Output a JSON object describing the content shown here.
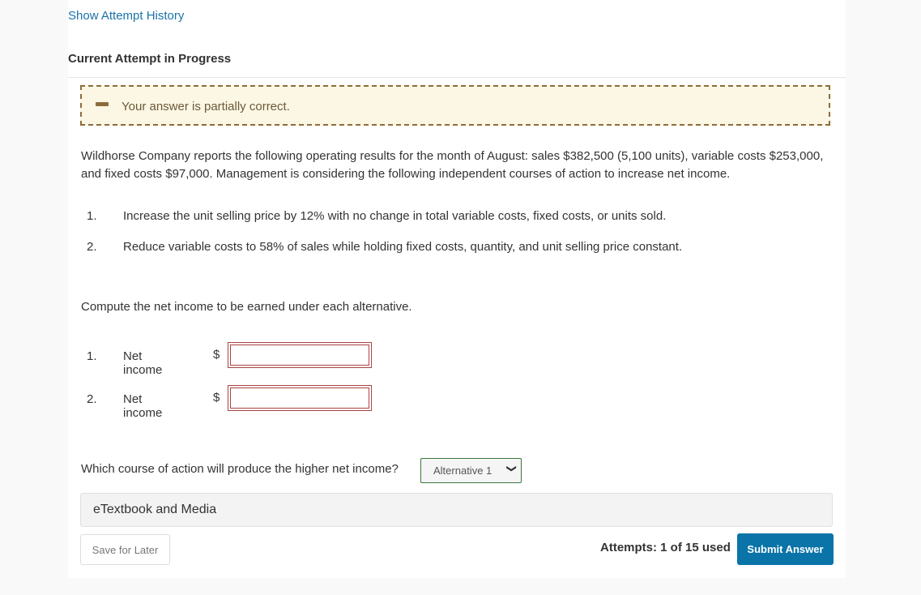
{
  "header": {
    "history_link": "Show Attempt History",
    "attempt_title": "Current Attempt in Progress"
  },
  "feedback": {
    "icon": "minus-icon",
    "message": "Your answer is partially correct."
  },
  "problem": {
    "statement": "Wildhorse Company reports the following operating results for the month of August: sales $382,500 (5,100 units), variable costs $253,000, and fixed costs $97,000. Management is considering the following independent courses of action to increase net income.",
    "alternatives": [
      {
        "num": "1.",
        "text": "Increase the unit selling price by 12% with no change in total variable costs, fixed costs, or units sold."
      },
      {
        "num": "2.",
        "text": "Reduce variable costs to 58% of sales while holding fixed costs, quantity, and unit selling price constant."
      }
    ],
    "prompt": "Compute the net income to be earned under each alternative."
  },
  "answers": [
    {
      "num": "1.",
      "label": "Net income",
      "currency": "$",
      "value": ""
    },
    {
      "num": "2.",
      "label": "Net income",
      "currency": "$",
      "value": ""
    }
  ],
  "choice": {
    "question": "Which course of action will produce the higher net income?",
    "selected": "Alternative 1"
  },
  "etextbook": "eTextbook and Media",
  "footer": {
    "save_label": "Save for Later",
    "attempts": "Attempts: 1 of 15 used",
    "submit_label": "Submit Answer"
  },
  "colors": {
    "link": "#1a73a8",
    "feedback_border": "#8b6d3b",
    "feedback_bg": "#fcf6e4",
    "input_error": "#a94442",
    "select_border": "#3c763d",
    "submit_bg": "#0a74a8"
  }
}
